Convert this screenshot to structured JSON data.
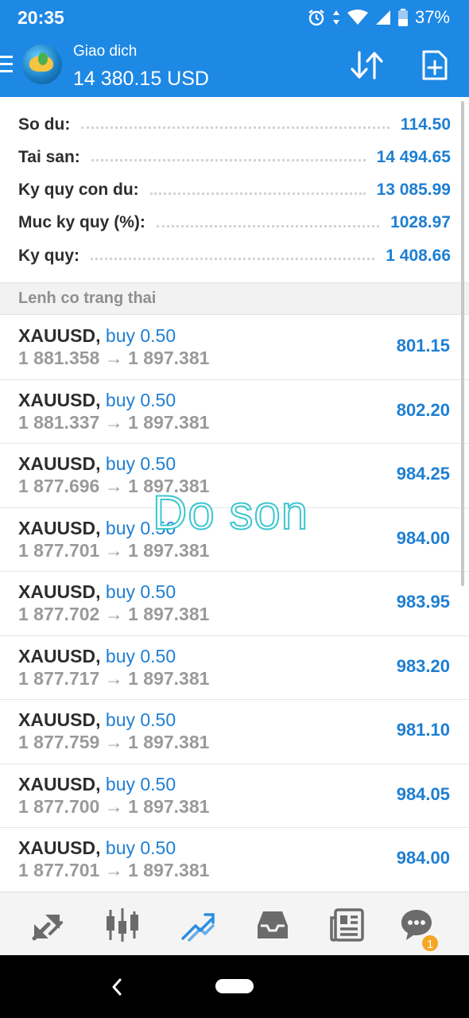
{
  "status_bar": {
    "time": "20:35",
    "battery": "37%"
  },
  "header": {
    "title": "Giao dich",
    "balance": "14 380.15 USD"
  },
  "summary": [
    {
      "label": "So du:",
      "value": "114.50"
    },
    {
      "label": "Tai san:",
      "value": "14 494.65"
    },
    {
      "label": "Ky quy con du:",
      "value": "13 085.99"
    },
    {
      "label": "Muc ky quy (%):",
      "value": "1028.97"
    },
    {
      "label": "Ky quy:",
      "value": "1 408.66"
    }
  ],
  "section": {
    "title": "Lenh co trang thai"
  },
  "positions": [
    {
      "symbol": "XAUUSD,",
      "side": "buy 0.50",
      "prices": "1 881.358 → 1 897.381",
      "profit": "801.15"
    },
    {
      "symbol": "XAUUSD,",
      "side": "buy 0.50",
      "prices": "1 881.337 → 1 897.381",
      "profit": "802.20"
    },
    {
      "symbol": "XAUUSD,",
      "side": "buy 0.50",
      "prices": "1 877.696 → 1 897.381",
      "profit": "984.25"
    },
    {
      "symbol": "XAUUSD,",
      "side": "buy 0.50",
      "prices": "1 877.701 → 1 897.381",
      "profit": "984.00"
    },
    {
      "symbol": "XAUUSD,",
      "side": "buy 0.50",
      "prices": "1 877.702 → 1 897.381",
      "profit": "983.95"
    },
    {
      "symbol": "XAUUSD,",
      "side": "buy 0.50",
      "prices": "1 877.717 → 1 897.381",
      "profit": "983.20"
    },
    {
      "symbol": "XAUUSD,",
      "side": "buy 0.50",
      "prices": "1 877.759 → 1 897.381",
      "profit": "981.10"
    },
    {
      "symbol": "XAUUSD,",
      "side": "buy 0.50",
      "prices": "1 877.700 → 1 897.381",
      "profit": "984.05"
    },
    {
      "symbol": "XAUUSD,",
      "side": "buy 0.50",
      "prices": "1 877.701 → 1 897.381",
      "profit": "984.00"
    }
  ],
  "watermark": "Do son",
  "bottom_nav": {
    "items": [
      "quotes-icon",
      "chart-icon",
      "trade-icon",
      "history-icon",
      "news-icon",
      "messages-icon"
    ],
    "messages_badge": "1"
  },
  "colors": {
    "primary": "#1e88e5",
    "value_blue": "#1e7fd2",
    "badge": "#f5a623",
    "watermark_stroke": "#3cc6cf"
  }
}
